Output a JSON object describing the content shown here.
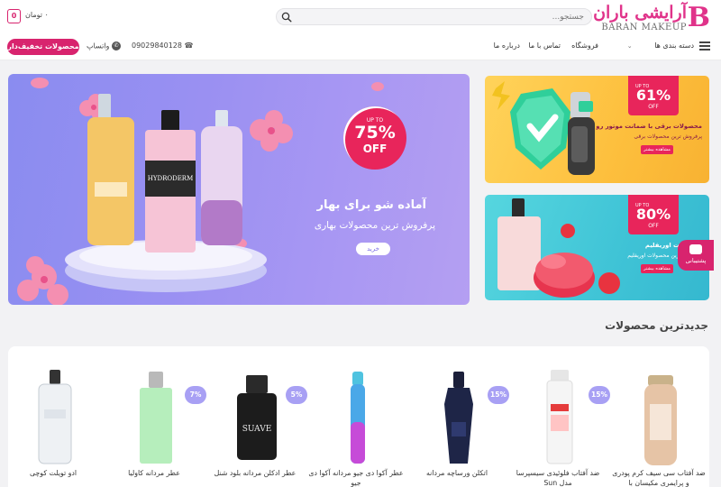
{
  "header": {
    "logo": {
      "title": "آرایشی باران",
      "subtitle": "BARAN MAKEUP"
    },
    "search": {
      "placeholder": "جستجو..."
    },
    "cart": {
      "count": "0",
      "total": "۰ تومان"
    },
    "nav": [
      {
        "label": "دسته بندی ها"
      },
      {
        "label": "فروشگاه"
      },
      {
        "label": "تماس با ما"
      },
      {
        "label": "درباره ما"
      }
    ],
    "phone": "09029840128",
    "whatsapp_label": "واتساپ",
    "discount_button": "محصولات تخفیف‌دار",
    "colors": {
      "brand": "#d8246e",
      "hero_bg": "#9a90f2"
    }
  },
  "hero": {
    "title": "آماده شو برای بهار",
    "subtitle": "پرفروش ترین محصولات بهاری",
    "button": "خرید",
    "badge": {
      "upto": "UP TO",
      "percent": "75%",
      "off": "OFF"
    }
  },
  "banners": [
    {
      "badge": {
        "upto": "UP TO",
        "percent": "61%",
        "off": "OFF"
      },
      "title": "محصولات برقی با ضمانت موتور رو",
      "subtitle": "پرفروش ترین محصولات برقی",
      "button": "مشاهده بیشتر"
    },
    {
      "badge": {
        "upto": "UP TO",
        "percent": "80%",
        "off": "OFF"
      },
      "title": "محصولات اوریفلیم",
      "subtitle": "پرفروش ترین محصولات اوریفلیم",
      "button": "مشاهده بیشتر"
    }
  ],
  "support_label": "پشتیبانی",
  "section": {
    "title": "جدیدترین محصولات"
  },
  "products": [
    {
      "name": "ضد آفتاب سی سیف کرم پودری و پرایمری مکیسان با",
      "discount": ""
    },
    {
      "name": "ضد آفتاب فلوئیدی سیسپرسا مدل Sun",
      "discount": "15%"
    },
    {
      "name": "اتکلن ورساچه مردانه",
      "discount": "15%"
    },
    {
      "name": "عطر آکوا دی جیو مردانه آکوا دی جیو",
      "discount": ""
    },
    {
      "name": "عطر ادکلن مردانه بلود شنل",
      "discount": "5%"
    },
    {
      "name": "عطر مردانه کاولیا",
      "discount": "7%"
    },
    {
      "name": "ادو تویلت کوچی",
      "discount": ""
    }
  ]
}
